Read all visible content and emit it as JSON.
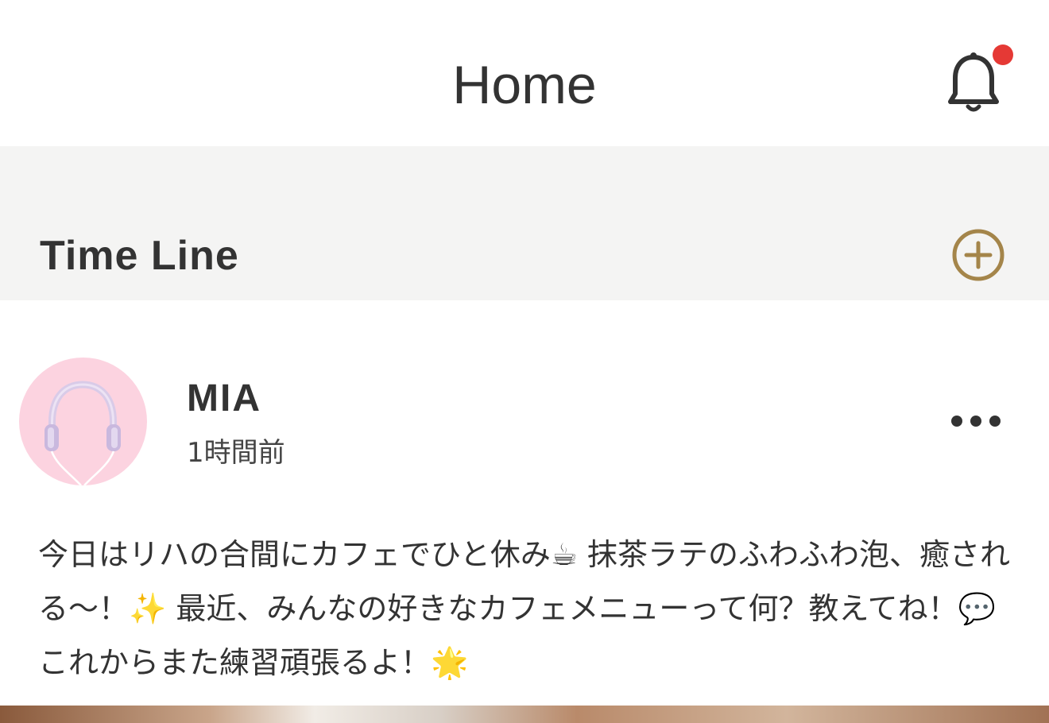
{
  "header": {
    "title": "Home"
  },
  "notifications": {
    "icon": "bell-icon",
    "badge_color": "#e53935",
    "has_unread": true
  },
  "timeline": {
    "title": "Time Line",
    "add_icon": "plus-circle-icon",
    "accent_color": "#a4854a"
  },
  "post": {
    "author": "MIA",
    "time": "1時間前",
    "avatar_icon": "headphones-avatar",
    "more_icon": "more-horizontal-icon",
    "body": "今日はリハの合間にカフェでひと休み☕ 抹茶ラテのふわふわ泡、癒される〜！✨ 最近、みんなの好きなカフェメニューって何？教えてね！💬 これからまた練習頑張るよ！🌟"
  }
}
